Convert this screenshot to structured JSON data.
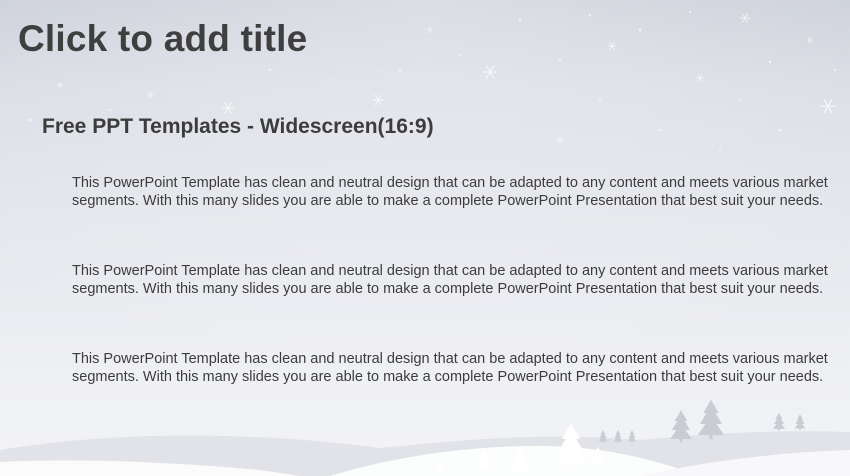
{
  "slide": {
    "title": "Click to add title",
    "subtitle": "Free PPT Templates - Widescreen(16:9)",
    "paragraphs": [
      "This PowerPoint Template has clean and neutral design that can be adapted to any content and meets various market segments. With this many slides you are able to make a complete PowerPoint Presentation that best suit your needs.",
      "This PowerPoint Template has clean and neutral design that can be adapted to any content and meets various market segments. With this many slides you are able to make a complete PowerPoint Presentation that best suit your needs.",
      "This PowerPoint Template has clean and neutral design that can be adapted to any content and meets various market segments. With this many slides you are able to make a complete PowerPoint Presentation that best suit your needs."
    ]
  },
  "colors": {
    "title_text": "#3f3f3f",
    "body_text": "#3c3c3c",
    "background_top": "#c8ccd6",
    "background_bottom": "#f3f4f7"
  },
  "icons": [
    "snowflake-icon",
    "pine-tree-icon"
  ]
}
